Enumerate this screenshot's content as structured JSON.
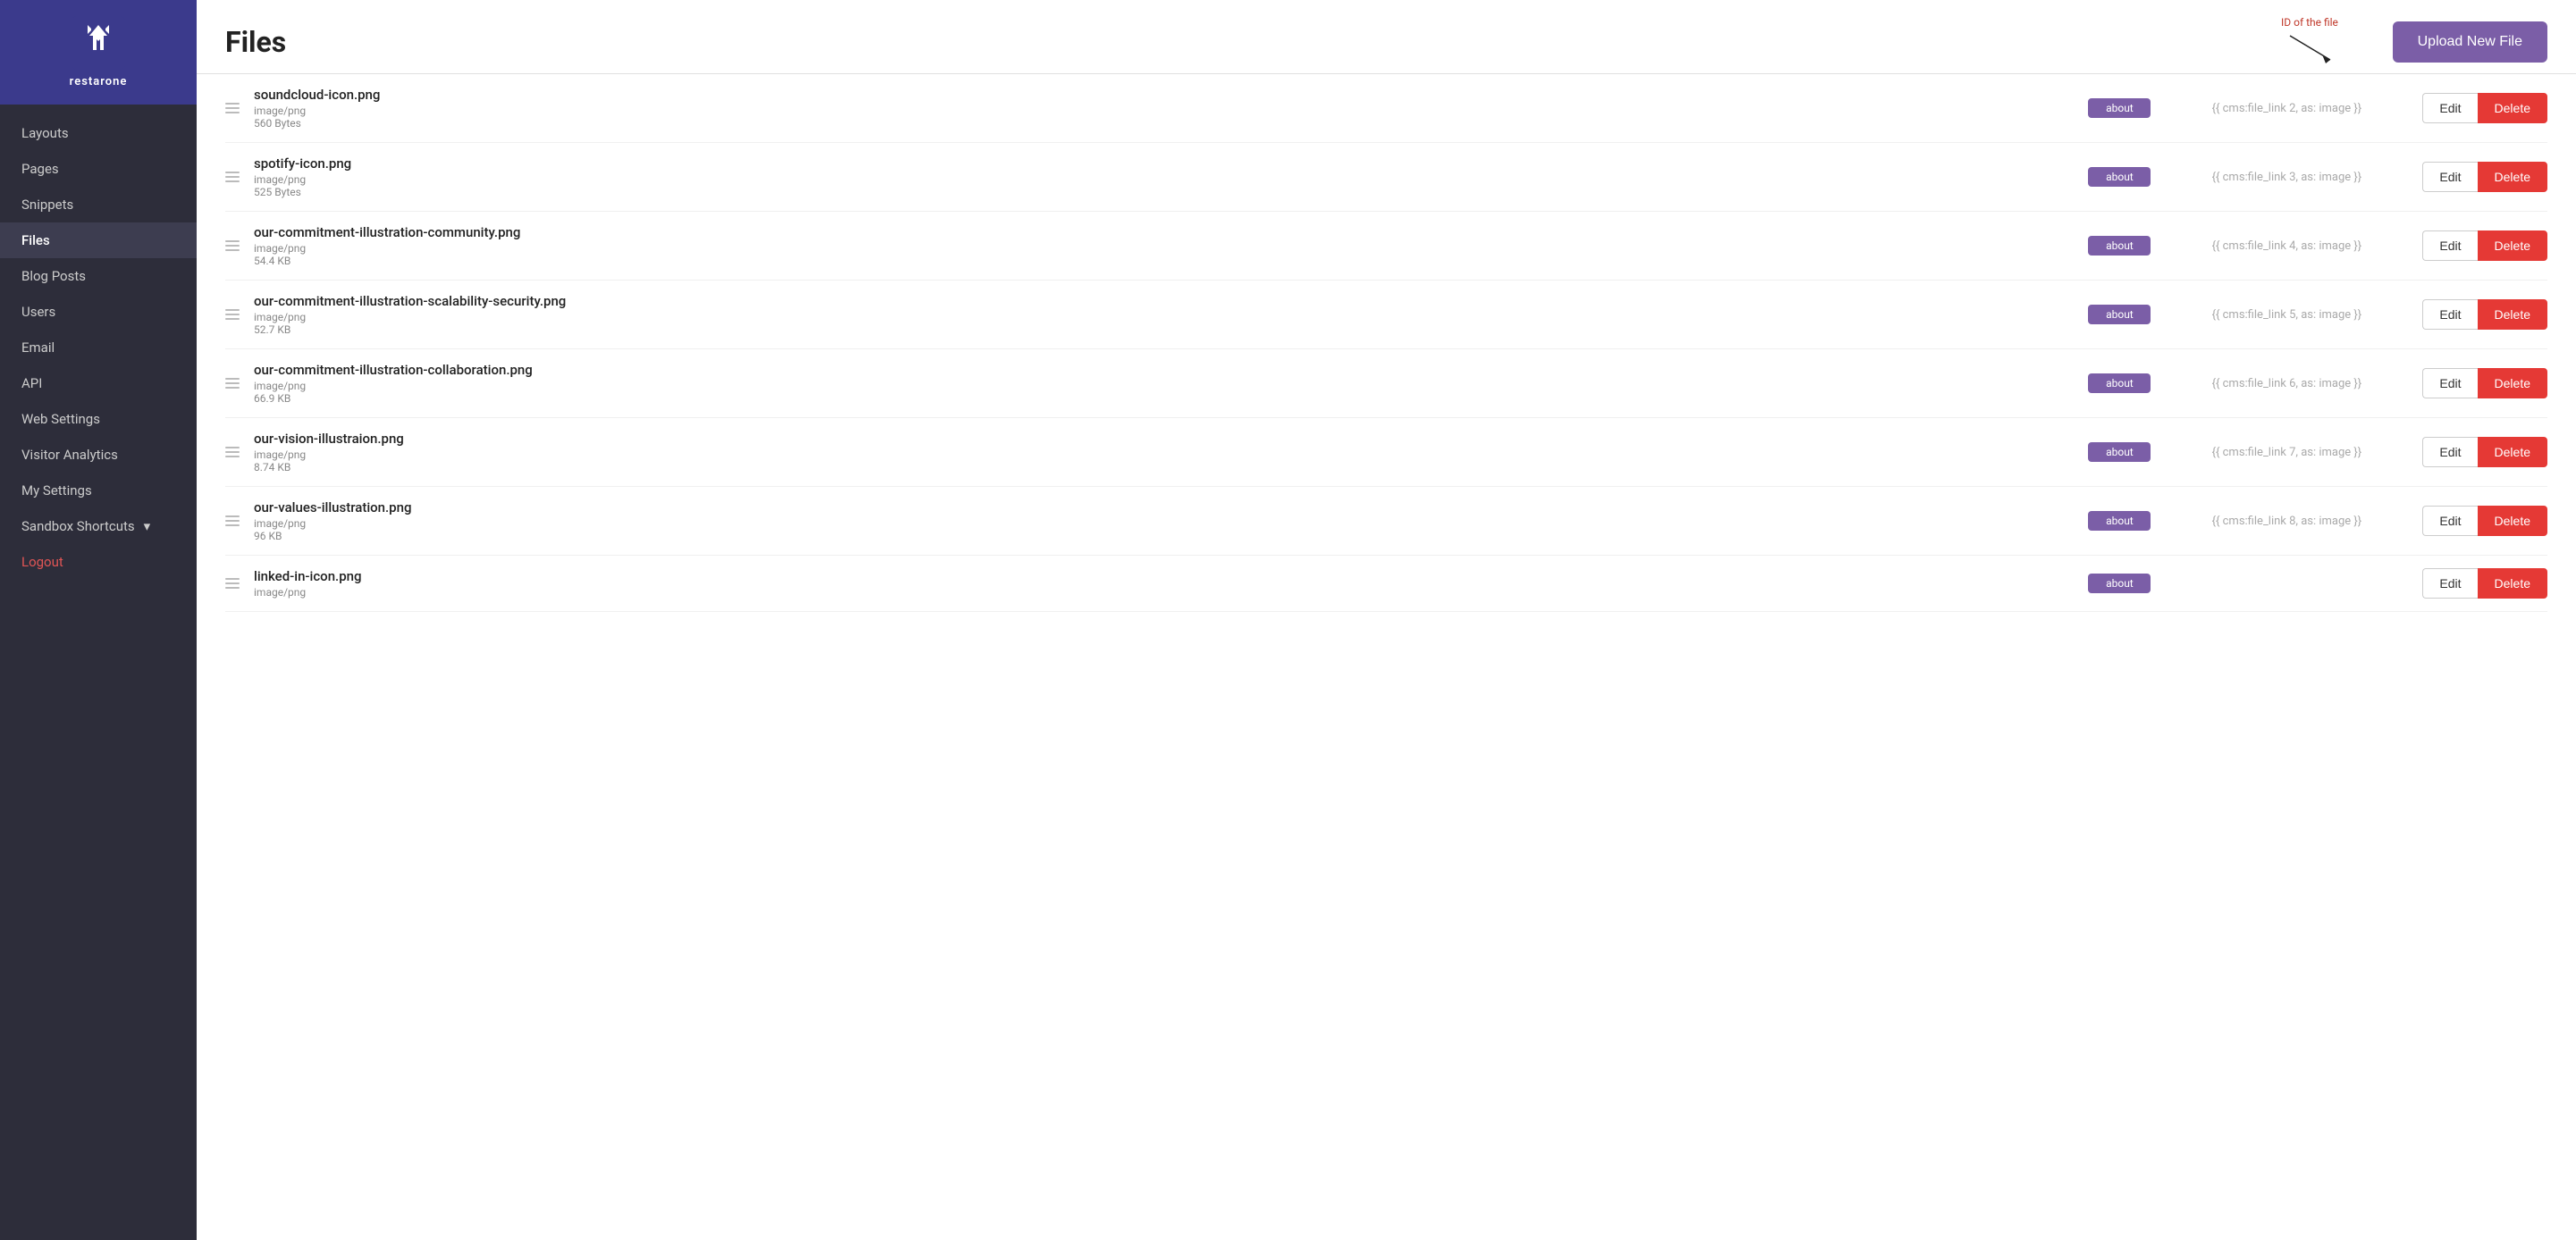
{
  "sidebar": {
    "logo_text": "restarone",
    "nav_items": [
      {
        "label": "Layouts",
        "id": "layouts",
        "active": false
      },
      {
        "label": "Pages",
        "id": "pages",
        "active": false
      },
      {
        "label": "Snippets",
        "id": "snippets",
        "active": false
      },
      {
        "label": "Files",
        "id": "files",
        "active": true
      },
      {
        "label": "Blog Posts",
        "id": "blog-posts",
        "active": false
      },
      {
        "label": "Users",
        "id": "users",
        "active": false
      },
      {
        "label": "Email",
        "id": "email",
        "active": false
      },
      {
        "label": "API",
        "id": "api",
        "active": false
      },
      {
        "label": "Web Settings",
        "id": "web-settings",
        "active": false
      },
      {
        "label": "Visitor Analytics",
        "id": "visitor-analytics",
        "active": false
      },
      {
        "label": "My Settings",
        "id": "my-settings",
        "active": false
      },
      {
        "label": "Sandbox Shortcuts",
        "id": "sandbox-shortcuts",
        "active": false,
        "has_arrow": true
      }
    ],
    "logout_label": "Logout"
  },
  "main": {
    "title": "Files",
    "upload_button_label": "Upload New File",
    "annotation_label": "ID of the file"
  },
  "files": [
    {
      "name": "soundcloud-icon.png",
      "type": "image/png",
      "size": "560 Bytes",
      "tag": "about",
      "link": "{{ cms:file_link 2, as: image }}",
      "id": "2"
    },
    {
      "name": "spotify-icon.png",
      "type": "image/png",
      "size": "525 Bytes",
      "tag": "about",
      "link": "{{ cms:file_link 3, as: image }}",
      "id": "3"
    },
    {
      "name": "our-commitment-illustration-community.png",
      "type": "image/png",
      "size": "54.4 KB",
      "tag": "about",
      "link": "{{ cms:file_link 4, as: image }}",
      "id": "4"
    },
    {
      "name": "our-commitment-illustration-scalability-security.png",
      "type": "image/png",
      "size": "52.7 KB",
      "tag": "about",
      "link": "{{ cms:file_link 5, as: image }}",
      "id": "5"
    },
    {
      "name": "our-commitment-illustration-collaboration.png",
      "type": "image/png",
      "size": "66.9 KB",
      "tag": "about",
      "link": "{{ cms:file_link 6, as: image }}",
      "id": "6"
    },
    {
      "name": "our-vision-illustraion.png",
      "type": "image/png",
      "size": "8.74 KB",
      "tag": "about",
      "link": "{{ cms:file_link 7, as: image }}",
      "id": "7"
    },
    {
      "name": "our-values-illustration.png",
      "type": "image/png",
      "size": "96 KB",
      "tag": "about",
      "link": "{{ cms:file_link 8, as: image }}",
      "id": "8"
    },
    {
      "name": "linked-in-icon.png",
      "type": "image/png",
      "size": "",
      "tag": "about",
      "link": "",
      "id": "9"
    }
  ],
  "buttons": {
    "edit_label": "Edit",
    "delete_label": "Delete"
  }
}
